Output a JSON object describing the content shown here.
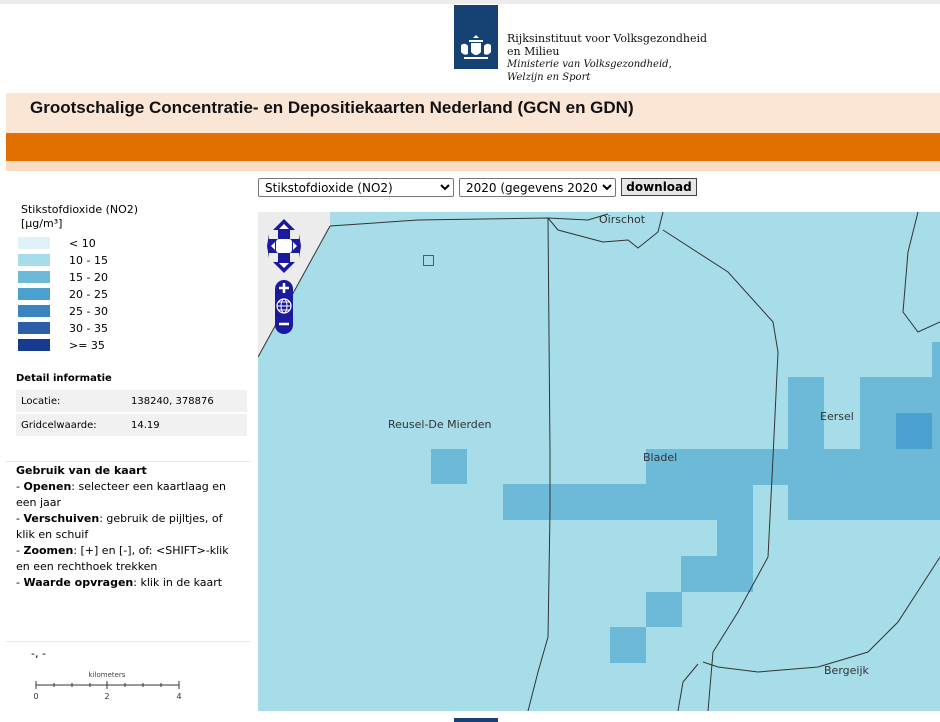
{
  "header": {
    "org_line1": "Rijksinstituut voor Volksgezondheid",
    "org_line2": "en Milieu",
    "ministry_line1": "Ministerie van Volksgezondheid,",
    "ministry_line2": "Welzijn en Sport",
    "page_title": "Grootschalige Concentratie- en Depositiekaarten Nederland (GCN en GDN)"
  },
  "controls": {
    "layer_selected": "Stikstofdioxide (NO2)",
    "year_selected": "2020 (gegevens 2020)",
    "download_label": "download"
  },
  "legend": {
    "title": "Stikstofdioxide (NO2)",
    "unit": "[µg/m³]",
    "classes": [
      {
        "label": "< 10",
        "color": "#dff2f7"
      },
      {
        "label": "10 - 15",
        "color": "#a6dde9"
      },
      {
        "label": "15 - 20",
        "color": "#6dbad8"
      },
      {
        "label": "20 - 25",
        "color": "#4aa0cf"
      },
      {
        "label": "25 - 30",
        "color": "#3a84bf"
      },
      {
        "label": "30 - 35",
        "color": "#2c5fa8"
      },
      {
        "label": ">= 35",
        "color": "#153b91"
      }
    ]
  },
  "detail": {
    "title": "Detail informatie",
    "rows": [
      {
        "key": "Locatie:",
        "value": "138240, 378876"
      },
      {
        "key": "Gridcelwaarde:",
        "value": "14.19"
      }
    ]
  },
  "usage": {
    "title": "Gebruik van de kaart",
    "items": [
      {
        "bold": "Openen",
        "text": ": selecteer een kaartlaag en een jaar"
      },
      {
        "bold": "Verschuiven",
        "text": ": gebruik de pijltjes, of klik en schuif"
      },
      {
        "bold": "Zoomen",
        "text": ": [+] en [-], of: <SHIFT>-klik en een rechthoek trekken"
      },
      {
        "bold": "Waarde opvragen",
        "text": ": klik in de kaart"
      }
    ]
  },
  "coordinates": "-, -",
  "scalebar": {
    "unit": "kilometers",
    "ticks": [
      "0",
      "2",
      "4"
    ]
  },
  "map": {
    "places": [
      "Oirschot",
      "Reusel-De Mierden",
      "Bladel",
      "Eersel",
      "Bergeijk"
    ],
    "icons": [
      "pan-arrows-icon",
      "zoom-in-icon",
      "globe-icon",
      "zoom-out-icon"
    ]
  },
  "colors": {
    "brand_blue": "#154273",
    "accent_orange": "#e17000",
    "band_peach": "#fbe6d6"
  }
}
